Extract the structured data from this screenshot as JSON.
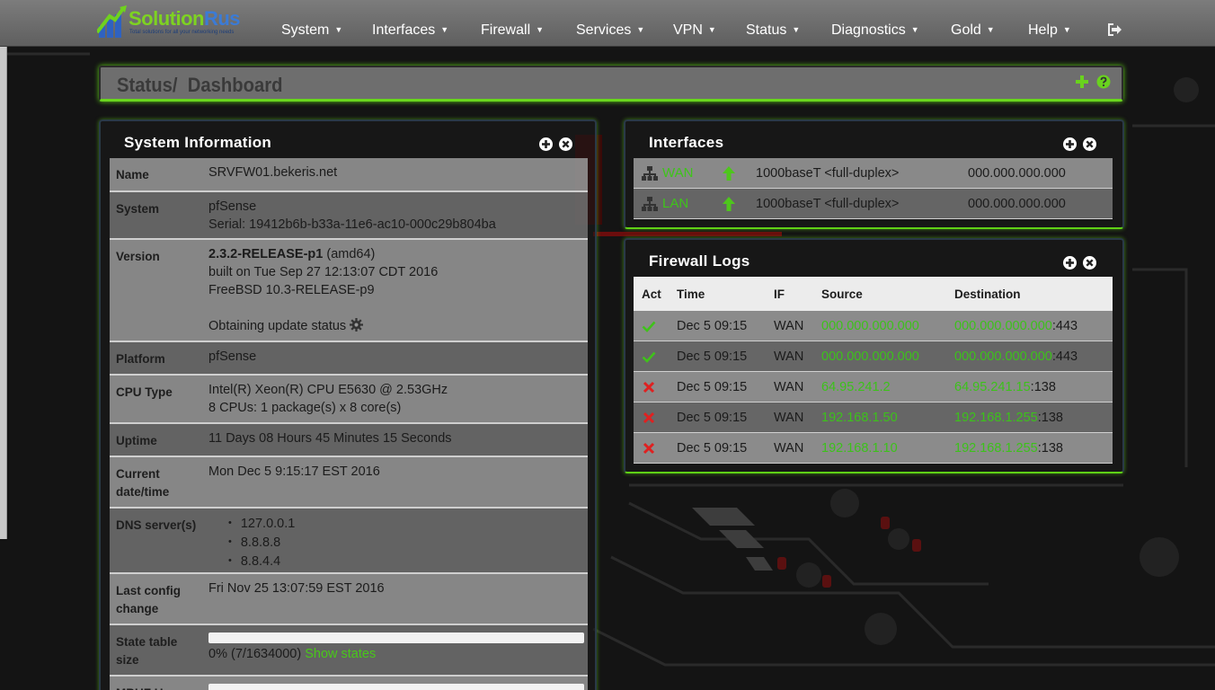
{
  "brand": {
    "name_part1": "Solution",
    "name_part2": "Rus",
    "tagline": "Total solutions for all your networking needs"
  },
  "nav": {
    "items": [
      {
        "label": "System"
      },
      {
        "label": "Interfaces"
      },
      {
        "label": "Firewall"
      },
      {
        "label": "Services"
      },
      {
        "label": "VPN"
      },
      {
        "label": "Status"
      },
      {
        "label": "Diagnostics"
      },
      {
        "label": "Gold"
      },
      {
        "label": "Help"
      }
    ]
  },
  "breadcrumb": {
    "section": "Status",
    "separator": "/",
    "page": "Dashboard"
  },
  "system_info": {
    "title": "System Information",
    "name_label": "Name",
    "name_value": "SRVFW01.bekeris.net",
    "system_label": "System",
    "system_value": "pfSense",
    "serial_prefix": "Serial:",
    "serial_value": "19412b6b-b33a-11e6-ac10-000c29b804ba",
    "version_label": "Version",
    "version_bold": "2.3.2-RELEASE-p1",
    "version_arch": "(amd64)",
    "version_built": "built on Tue Sep 27 12:13:07 CDT 2016",
    "version_os": "FreeBSD 10.3-RELEASE-p9",
    "update_status": "Obtaining update status",
    "platform_label": "Platform",
    "platform_value": "pfSense",
    "cpu_label": "CPU Type",
    "cpu_value": "Intel(R) Xeon(R) CPU E5630 @ 2.53GHz",
    "cpu_count": "8 CPUs: 1 package(s) x 8 core(s)",
    "uptime_label": "Uptime",
    "uptime_value": "11 Days 08 Hours 45 Minutes 15 Seconds",
    "datetime_label_1": "Current",
    "datetime_label_2": "date/time",
    "datetime_value": "Mon Dec 5 9:15:17 EST 2016",
    "dns_label": "DNS server(s)",
    "dns_servers": [
      "127.0.0.1",
      "8.8.8.8",
      "8.8.4.4"
    ],
    "lastconfig_label_1": "Last config",
    "lastconfig_label_2": "change",
    "lastconfig_value": "Fri Nov 25 13:07:59 EST 2016",
    "state_label_1": "State table",
    "state_label_2": "size",
    "state_value": "0%  (7/1634000)",
    "state_fill": 0.0,
    "state_link": "Show states",
    "mbuf_label": "MBUF Usage"
  },
  "interfaces": {
    "title": "Interfaces",
    "rows": [
      {
        "name": "WAN",
        "media": "1000baseT <full-duplex>",
        "ip": "000.000.000.000"
      },
      {
        "name": "LAN",
        "media": "1000baseT <full-duplex>",
        "ip": "000.000.000.000"
      }
    ]
  },
  "firewall_logs": {
    "title": "Firewall Logs",
    "headers": {
      "act": "Act",
      "time": "Time",
      "if": "IF",
      "source": "Source",
      "destination": "Destination"
    },
    "rows": [
      {
        "act": "pass",
        "time": "Dec 5 09:15",
        "if": "WAN",
        "source": "000.000.000.000",
        "dest_ip": "000.000.000.000",
        "dest_port": ":443"
      },
      {
        "act": "pass",
        "time": "Dec 5 09:15",
        "if": "WAN",
        "source": "000.000.000.000",
        "dest_ip": "000.000.000.000",
        "dest_port": ":443"
      },
      {
        "act": "block",
        "time": "Dec 5 09:15",
        "if": "WAN",
        "source": "64.95.241.2",
        "dest_ip": "64.95.241.15",
        "dest_port": ":138"
      },
      {
        "act": "block",
        "time": "Dec 5 09:15",
        "if": "WAN",
        "source": "192.168.1.50",
        "dest_ip": "192.168.1.255",
        "dest_port": ":138"
      },
      {
        "act": "block",
        "time": "Dec 5 09:15",
        "if": "WAN",
        "source": "192.168.1.10",
        "dest_ip": "192.168.1.255",
        "dest_port": ":138"
      }
    ]
  },
  "colors": {
    "accent_green": "#5fd016",
    "link_green": "#3ec41a",
    "block_red": "#e02020",
    "navbar": "#6d6d6d"
  }
}
